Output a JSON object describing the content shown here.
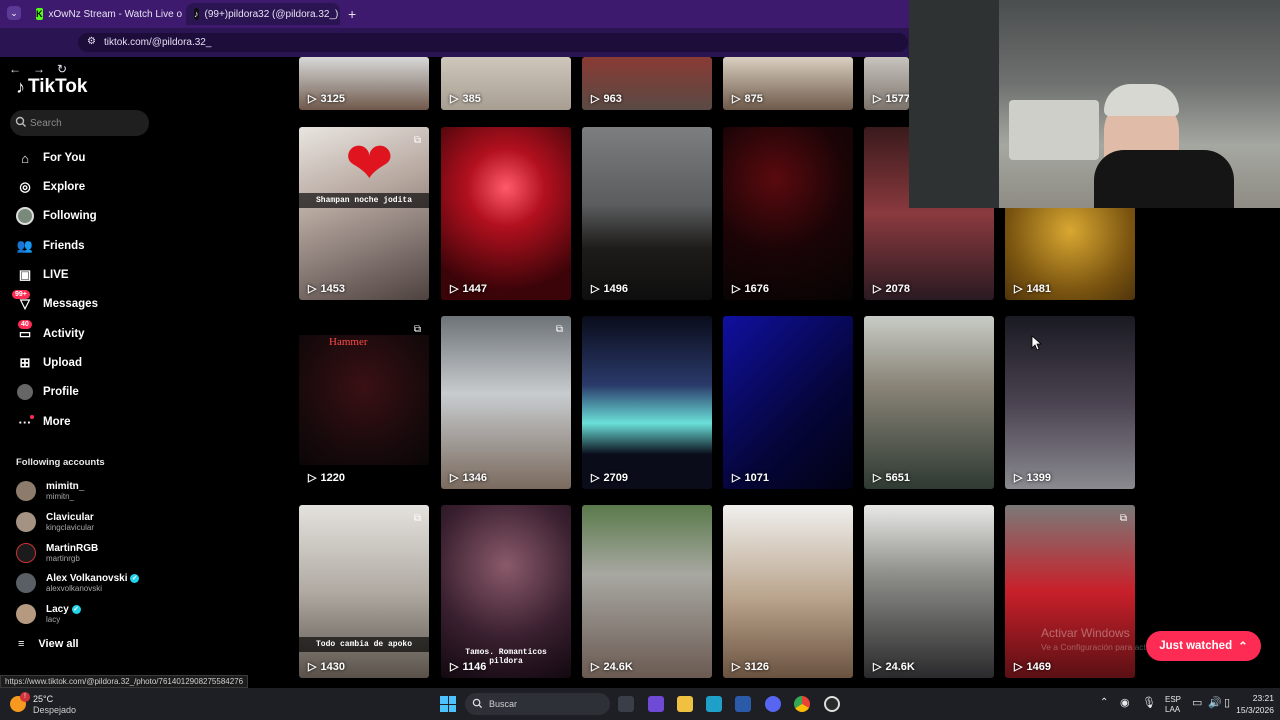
{
  "browser": {
    "tabs": [
      {
        "title": "xOwNz Stream - Watch Live on",
        "active": false
      },
      {
        "title": "(99+)pildora32 (@pildora.32_) |",
        "active": true
      }
    ],
    "url": "tiktok.com/@pildora.32_",
    "status_url": "https://www.tiktok.com/@pildora.32_/photo/7614012908275584276"
  },
  "sidebar": {
    "logo": "TikTok",
    "search_placeholder": "Search",
    "nav": [
      {
        "label": "For You",
        "icon": "home-icon"
      },
      {
        "label": "Explore",
        "icon": "compass-icon"
      },
      {
        "label": "Following",
        "icon": "avatar-icon"
      },
      {
        "label": "Friends",
        "icon": "friends-icon"
      },
      {
        "label": "LIVE",
        "icon": "live-icon"
      },
      {
        "label": "Messages",
        "icon": "messages-icon",
        "badge": "99+"
      },
      {
        "label": "Activity",
        "icon": "activity-icon",
        "badge": "40"
      },
      {
        "label": "Upload",
        "icon": "upload-icon"
      },
      {
        "label": "Profile",
        "icon": "profile-icon"
      },
      {
        "label": "More",
        "icon": "more-icon"
      }
    ],
    "following_title": "Following accounts",
    "accounts": [
      {
        "name": "mimitn_",
        "handle": "mimitn_",
        "verified": false
      },
      {
        "name": "Clavicular",
        "handle": "kingclavicular",
        "verified": false
      },
      {
        "name": "MartinRGB",
        "handle": "martinrgb",
        "verified": false
      },
      {
        "name": "Alex Volkanovski",
        "handle": "alexvolkanovski",
        "verified": true
      },
      {
        "name": "Lacy",
        "handle": "lacy",
        "verified": true
      }
    ],
    "view_all": "View all"
  },
  "grid": {
    "rows": [
      [
        "3125",
        "385",
        "963",
        "875",
        "1577"
      ],
      [
        "1453",
        "1447",
        "1496",
        "1676",
        "2078",
        "1481"
      ],
      [
        "1220",
        "1346",
        "2709",
        "1071",
        "5651",
        "1399"
      ],
      [
        "1430",
        "1146",
        "24.6K",
        "3126",
        "24.6K",
        "1469"
      ]
    ],
    "captions": {
      "shampan": "Shampan noche jodita",
      "todo": "Todo cambia de apoko",
      "tamos": "Tamos. Romanticos",
      "pildora": "pildora"
    },
    "colors": {
      "accent": "#fe2c55",
      "verified": "#20d5ec"
    }
  },
  "overlay": {
    "just_watched": "Just watched",
    "activate_title": "Activar Windows",
    "activate_sub": "Ve a Configuración para activar Windows."
  },
  "taskbar": {
    "weather_temp": "25°C",
    "weather_desc": "Despejado",
    "search": "Buscar",
    "lang": "ESP",
    "lang2": "LAA",
    "time": "23:21",
    "date": "15/3/2026"
  }
}
